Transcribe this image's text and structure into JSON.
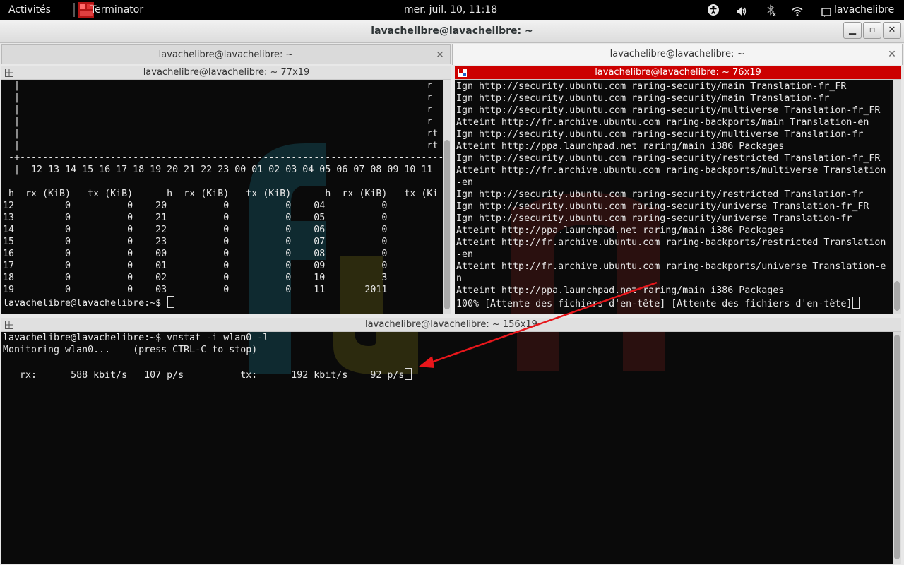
{
  "topbar": {
    "activities": "Activités",
    "app_name": "Terminator",
    "clock": "mer. juil. 10, 11:18",
    "user": "lavachelibre"
  },
  "window": {
    "title": "lavachelibre@lavachelibre: ~"
  },
  "tabs": [
    {
      "label": "lavachelibre@lavachelibre: ~",
      "close": "✕"
    },
    {
      "label": "lavachelibre@lavachelibre: ~",
      "close": "✕"
    }
  ],
  "panes": {
    "top_left": {
      "title": "lavachelibre@lavachelibre: ~ 77x19",
      "lines": [
        "  |                                                                        r",
        "  |                                                                        r",
        "  |                                                                        r",
        "  |                                                                        r",
        "  |                                                                        rt",
        "  |                                                                        rt",
        " -+---------------------------------------------------------------------------",
        "  |  12 13 14 15 16 17 18 19 20 21 22 23 00 01 02 03 04 05 06 07 08 09 10 11",
        "",
        " h  rx (KiB)   tx (KiB)      h  rx (KiB)   tx (KiB)      h  rx (KiB)   tx (Ki",
        "12         0          0    20          0          0    04          0",
        "13         0          0    21          0          0    05          0",
        "14         0          0    22          0          0    06          0",
        "15         0          0    23          0          0    07          0",
        "16         0          0    00          0          0    08          0",
        "17         0          0    01          0          0    09          0",
        "18         0          0    02          0          0    10          3",
        "19         0          0    03          0          0    11       2011"
      ],
      "prompt": "lavachelibre@lavachelibre:~$ "
    },
    "top_right": {
      "title": "lavachelibre@lavachelibre: ~ 76x19",
      "lines": [
        "Ign http://security.ubuntu.com raring-security/main Translation-fr_FR",
        "Ign http://security.ubuntu.com raring-security/main Translation-fr",
        "Ign http://security.ubuntu.com raring-security/multiverse Translation-fr_FR",
        "Atteint http://fr.archive.ubuntu.com raring-backports/main Translation-en",
        "Ign http://security.ubuntu.com raring-security/multiverse Translation-fr",
        "Atteint http://ppa.launchpad.net raring/main i386 Packages",
        "Ign http://security.ubuntu.com raring-security/restricted Translation-fr_FR",
        "Atteint http://fr.archive.ubuntu.com raring-backports/multiverse Translation",
        "-en",
        "Ign http://security.ubuntu.com raring-security/restricted Translation-fr",
        "Ign http://security.ubuntu.com raring-security/universe Translation-fr_FR",
        "Ign http://security.ubuntu.com raring-security/universe Translation-fr",
        "Atteint http://ppa.launchpad.net raring/main i386 Packages",
        "Atteint http://fr.archive.ubuntu.com raring-backports/restricted Translation",
        "-en",
        "Atteint http://fr.archive.ubuntu.com raring-backports/universe Translation-e",
        "n",
        "Atteint http://ppa.launchpad.net raring/main i386 Packages"
      ],
      "status": "100% [Attente des fichiers d'en-tête] [Attente des fichiers d'en-tête]"
    },
    "bottom": {
      "title": "lavachelibre@lavachelibre: ~ 156x19",
      "lines": [
        "lavachelibre@lavachelibre:~$ vnstat -i wlan0 -l",
        "Monitoring wlan0...    (press CTRL-C to stop)",
        ""
      ],
      "live": "   rx:      588 kbit/s   107 p/s          tx:      192 kbit/s    92 p/s"
    }
  },
  "colors": {
    "active_header": "#cc0000",
    "annotation_arrow": "#e8161b"
  }
}
